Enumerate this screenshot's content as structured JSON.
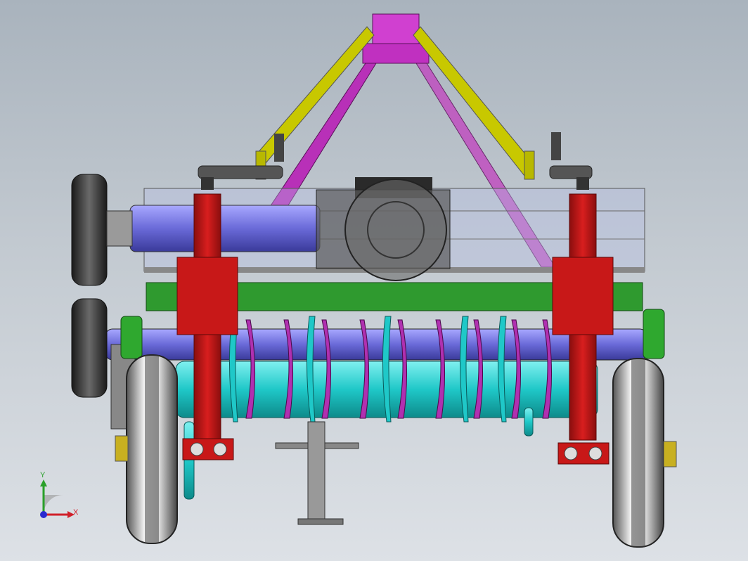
{
  "viewport": {
    "background_top": "#a9b3bd",
    "background_bottom": "#dde1e6"
  },
  "model": {
    "description_colors": {
      "hitch_mast": "#cc33cc",
      "top_link_arms": "#c8c800",
      "side_frames": "#c81818",
      "cross_beam": "#2f9a2f",
      "upper_shaft": "#6a6acc",
      "lower_rotor": "#1fc8c8",
      "blades": "#b030b0",
      "gear_hubs": "#2fa82f",
      "tires": "#3a3a3a",
      "pulleys": "#2a2a2a"
    }
  },
  "triad": {
    "x_label": "X",
    "y_label": "Y",
    "x_color": "#d0202a",
    "y_color": "#2aa02a",
    "z_color": "#2a2ad0"
  }
}
